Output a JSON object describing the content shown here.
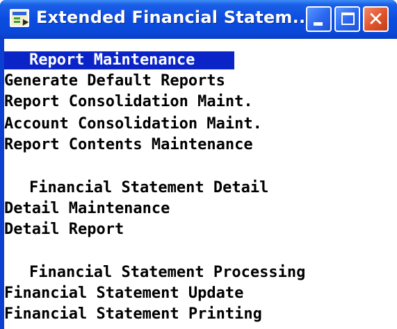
{
  "window": {
    "title": "Extended Financial Statem...",
    "icons": {
      "app": "terminal-window-icon",
      "minimize": "minimize-icon",
      "maximize": "maximize-icon",
      "close": "close-icon"
    },
    "close_glyph": "✕"
  },
  "colors": {
    "titlebar": "#0a4ce0",
    "selection": "#0a24c8",
    "close_button": "#e0532a"
  },
  "menu": {
    "selected_item": "Report Maintenance",
    "items": [
      "Generate Default Reports",
      "Report Consolidation Maint.",
      "Account Consolidation Maint.",
      "Report Contents Maintenance"
    ],
    "section_detail": {
      "heading": "Financial Statement Detail",
      "items": [
        "Detail Maintenance",
        "Detail Report"
      ]
    },
    "section_processing": {
      "heading": "Financial Statement Processing",
      "items": [
        "Financial Statement Update",
        "Financial Statement Printing"
      ]
    }
  }
}
